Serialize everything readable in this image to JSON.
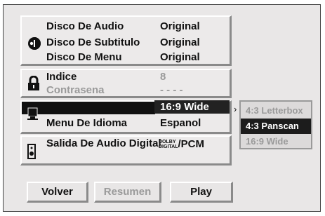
{
  "audio_panel": {
    "rows": [
      {
        "label": "Disco De Audio",
        "value": "Original"
      },
      {
        "label": "Disco De Subtitulo",
        "value": "Original"
      },
      {
        "label": "Disco De Menu",
        "value": "Original"
      }
    ]
  },
  "lock_panel": {
    "rows": [
      {
        "label": "Indice",
        "value": "8"
      },
      {
        "label": "Contrasena",
        "value": "- - - -"
      }
    ]
  },
  "tv_panel": {
    "selected_value": "16:9 Wide",
    "language_label": "Menu De Idioma",
    "language_value": "Espanol"
  },
  "aspect_submenu": {
    "options": [
      "4:3 Letterbox",
      "4:3 Panscan",
      "16:9 Wide"
    ],
    "selected_index": 1
  },
  "digital_panel": {
    "label": "Salida De Audio Digital",
    "dolby_line1": "DOLBY",
    "dolby_line2": "DIGITAL",
    "value_suffix": "/PCM"
  },
  "buttons": {
    "back": "Volver",
    "resume": "Resumen",
    "play": "Play"
  }
}
